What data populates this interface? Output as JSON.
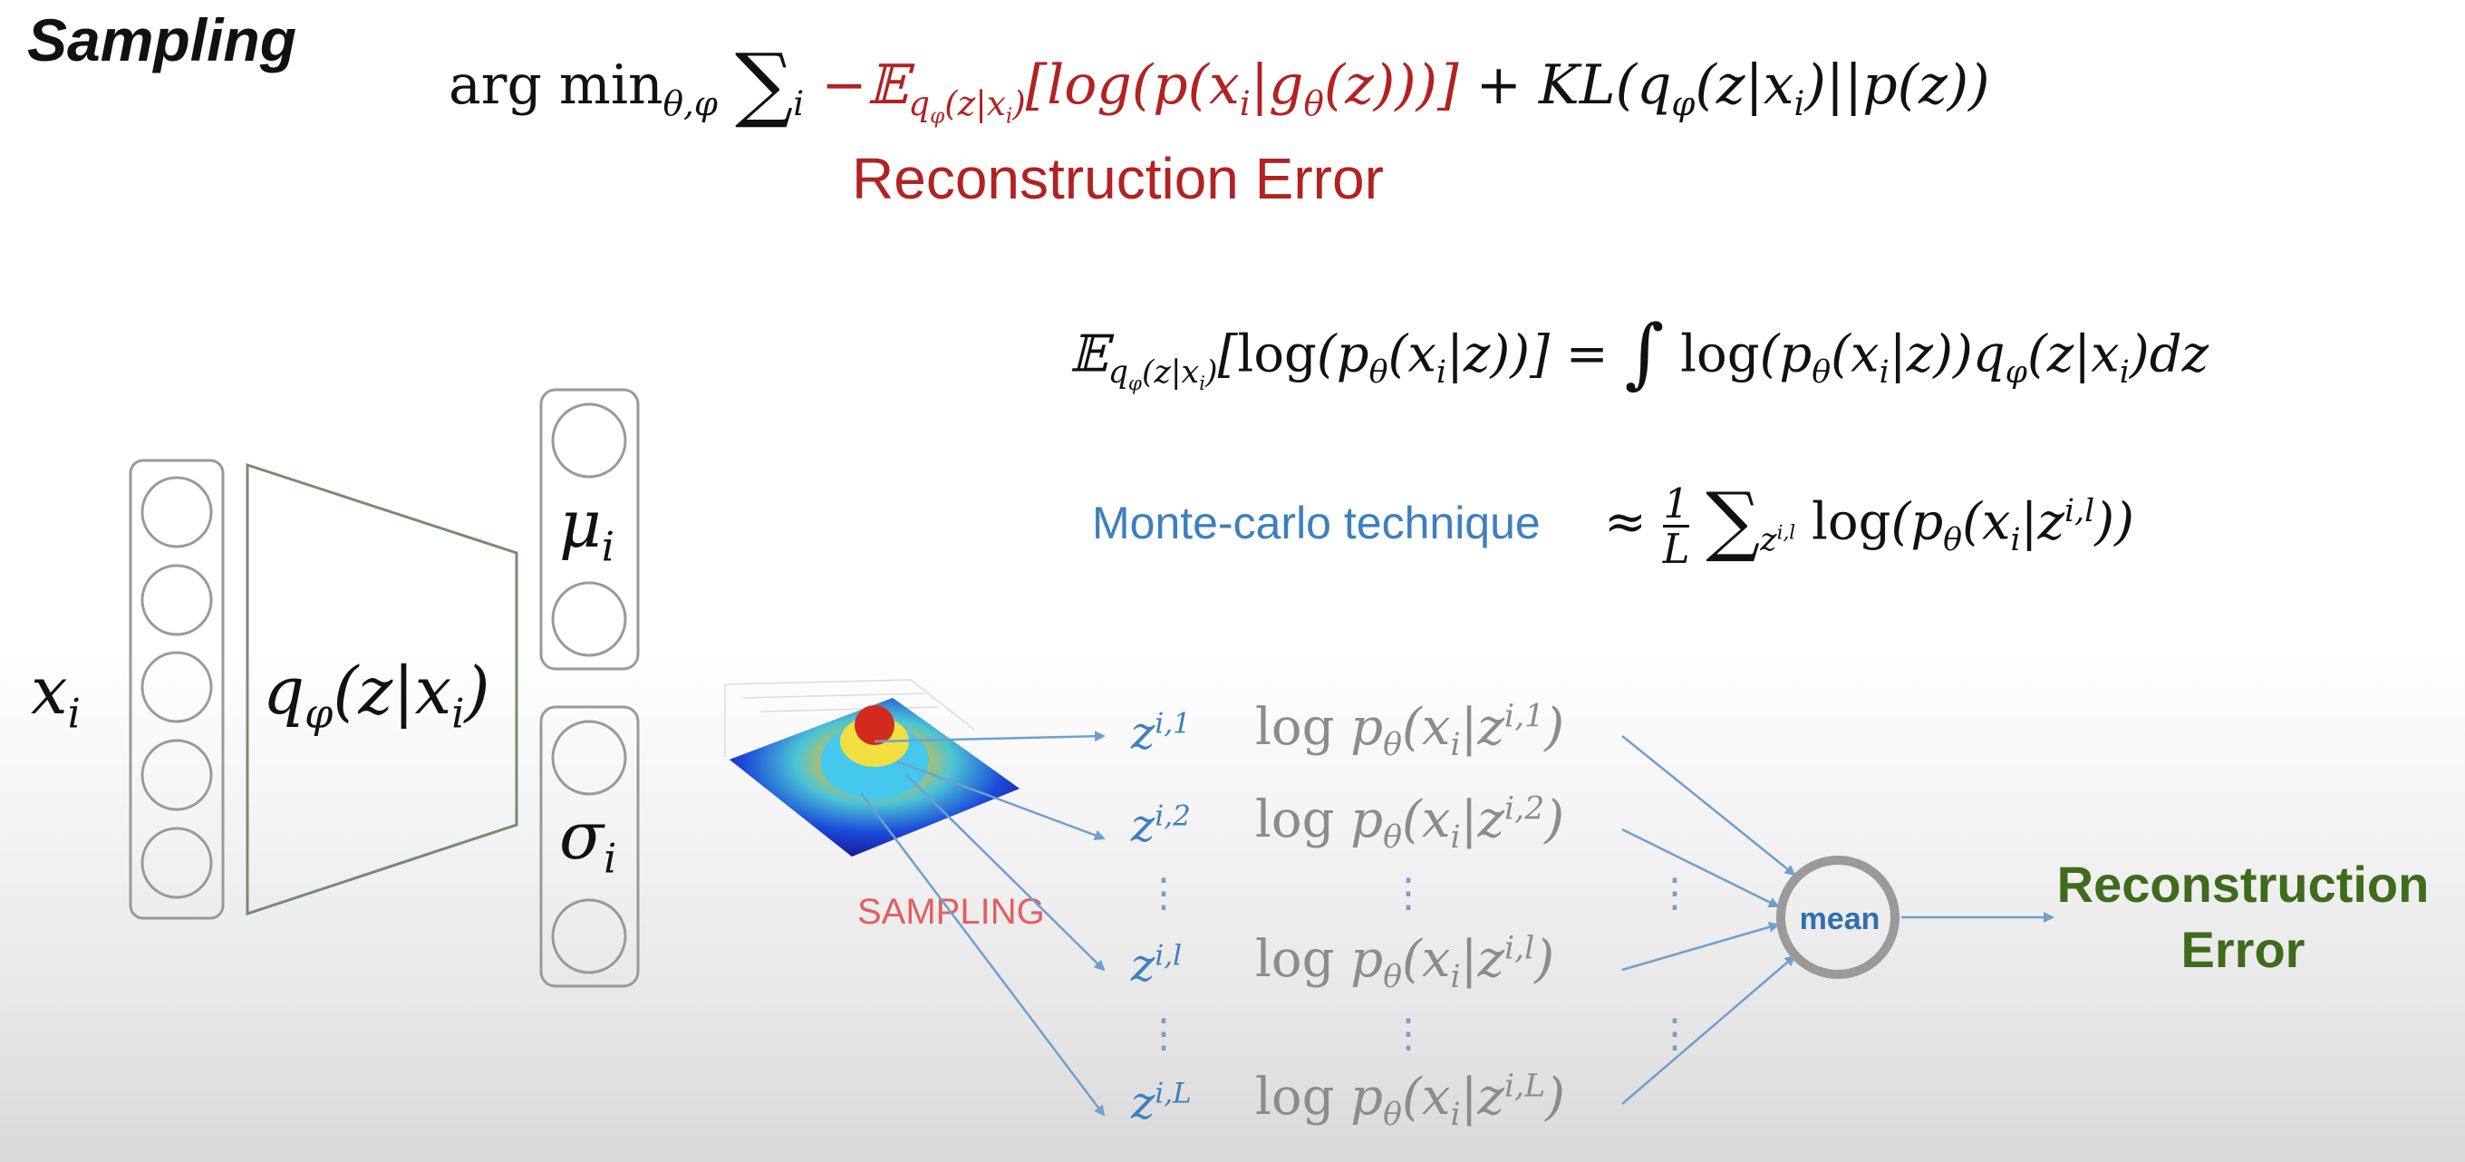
{
  "title": "Sampling",
  "objective": {
    "prefix": "arg min",
    "sub": "θ,φ",
    "sum_index": "i",
    "recon_term": "−𝔼q_φ(z|x_i)[log(p(x_i|g_θ(z)))]",
    "kl_term": "+ KL(q_φ(z|x_i)||p(z))"
  },
  "recon_label": "Reconstruction Error",
  "expectation_formula": "𝔼q_φ(z|x_i)[log(p_θ(x_i|z))] = ∫ log(p_θ(x_i|z))q_φ(z|x_i)dz",
  "mc_label": "Monte-carlo technique",
  "mc_formula": "≈ 1/L Σ_{z^{i,l}} log(p_θ(x_i|z^{i,l}))",
  "input_label": "x_i",
  "encoder_label": "q_φ(z|x_i)",
  "mu_label": "μ_i",
  "sigma_label": "σ_i",
  "sampling_label": "SAMPLING",
  "samples": [
    {
      "z": "z^{i,1}",
      "logp": "log p_θ(x_i|z^{i,1})"
    },
    {
      "z": "z^{i,2}",
      "logp": "log p_θ(x_i|z^{i,2})"
    },
    {
      "z": "z^{i,l}",
      "logp": "log p_θ(x_i|z^{i,l})"
    },
    {
      "z": "z^{i,L}",
      "logp": "log p_θ(x_i|z^{i,L})"
    }
  ],
  "mean_label": "mean",
  "output_label": "Reconstruction Error",
  "colors": {
    "red": "#b22222",
    "blue": "#3d7fbf",
    "green": "#3e6b1c",
    "gray": "#8c8c8c"
  }
}
